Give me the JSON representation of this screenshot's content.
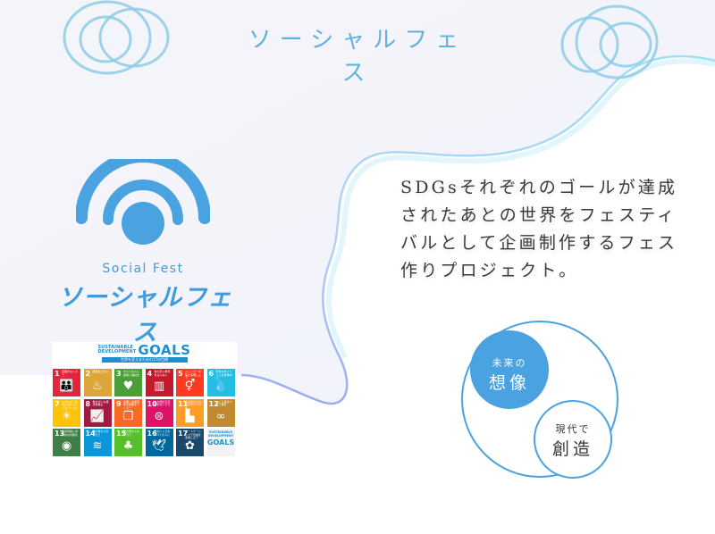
{
  "header": {
    "title": "ソーシャルフェス"
  },
  "logo": {
    "english_name": "Social Fest",
    "japanese_name": "ソーシャルフェス",
    "icon": "broadcast-signal-icon",
    "brand_color": "#3f9bdc"
  },
  "description": {
    "text": "SDGsそれぞれのゴールが達成されたあとの世界をフェスティバルとして企画制作するフェス作りプロジェクト。"
  },
  "sdgs": {
    "header_line1": "SUSTAINABLE",
    "header_line2": "DEVELOPMENT",
    "header_goals": "GOALS",
    "header_ribbon": "世界を変えるための17の目標",
    "goals": [
      {
        "num": "1",
        "label": "貧困をなくそう",
        "icon": "people-icon",
        "glyph": "👪",
        "color": "#e5243b"
      },
      {
        "num": "2",
        "label": "飢餓をゼロに",
        "icon": "bowl-icon",
        "glyph": "♨",
        "color": "#dda63a"
      },
      {
        "num": "3",
        "label": "すべての人に健康と福祉を",
        "icon": "heartbeat-icon",
        "glyph": "♥",
        "color": "#4c9f38"
      },
      {
        "num": "4",
        "label": "質の高い教育をみんなに",
        "icon": "book-icon",
        "glyph": "▥",
        "color": "#c5192d"
      },
      {
        "num": "5",
        "label": "ジェンダー平等を実現しよう",
        "icon": "gender-icon",
        "glyph": "⚥",
        "color": "#ff3a21"
      },
      {
        "num": "6",
        "label": "安全な水とトイレを世界中に",
        "icon": "water-drop-icon",
        "glyph": "💧",
        "color": "#26bde2"
      },
      {
        "num": "7",
        "label": "エネルギーをみんなにそしてクリーンに",
        "icon": "sun-icon",
        "glyph": "☀",
        "color": "#fcc30b"
      },
      {
        "num": "8",
        "label": "働きがいも経済成長も",
        "icon": "growth-chart-icon",
        "glyph": "📈",
        "color": "#a21942"
      },
      {
        "num": "9",
        "label": "産業と技術革新の基盤をつくろう",
        "icon": "cubes-icon",
        "glyph": "❒",
        "color": "#fd6925"
      },
      {
        "num": "10",
        "label": "人や国の不平等をなくそう",
        "icon": "equal-icon",
        "glyph": "⊜",
        "color": "#dd1367"
      },
      {
        "num": "11",
        "label": "住み続けられるまちづくりを",
        "icon": "city-icon",
        "glyph": "▙",
        "color": "#fd9d24"
      },
      {
        "num": "12",
        "label": "つくる責任つかう責任",
        "icon": "infinity-icon",
        "glyph": "∞",
        "color": "#bf8b2e"
      },
      {
        "num": "13",
        "label": "気候変動に具体的な対策を",
        "icon": "eye-globe-icon",
        "glyph": "◉",
        "color": "#3f7e44"
      },
      {
        "num": "14",
        "label": "海の豊かさを守ろう",
        "icon": "fish-icon",
        "glyph": "≋",
        "color": "#0a97d9"
      },
      {
        "num": "15",
        "label": "陸の豊かさも守ろう",
        "icon": "tree-icon",
        "glyph": "♣",
        "color": "#56c02b"
      },
      {
        "num": "16",
        "label": "平和と公正をすべての人に",
        "icon": "dove-icon",
        "glyph": "🕊",
        "color": "#00689d"
      },
      {
        "num": "17",
        "label": "パートナーシップで目標を達成しよう",
        "icon": "flower-rings-icon",
        "glyph": "✿",
        "color": "#19486a"
      }
    ],
    "logo_tile": {
      "line1": "SUSTAINABLE",
      "line2": "DEVELOPMENT",
      "goals": "GOALS"
    }
  },
  "venn": {
    "future_small": "未来の",
    "future_big": "想像",
    "present_small": "現代で",
    "present_big": "創造",
    "accent_color": "#4aa3e0"
  }
}
